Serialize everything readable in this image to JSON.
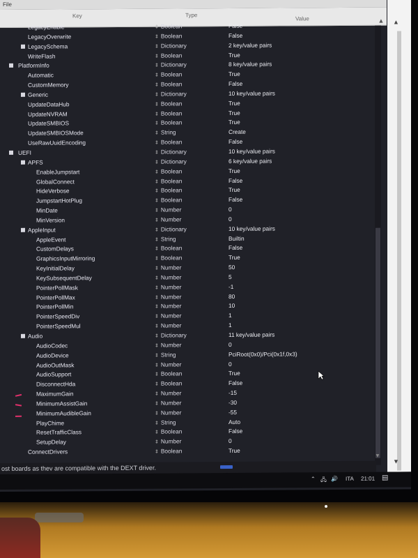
{
  "menu": {
    "file_label": "File"
  },
  "columns": {
    "key": "Key",
    "type": "Type",
    "value": "Value"
  },
  "rows": [
    {
      "key": "LegacyEnable",
      "indent": 2,
      "group": false,
      "type": "Boolean",
      "value": "False"
    },
    {
      "key": "LegacyOverwrite",
      "indent": 2,
      "group": false,
      "type": "Boolean",
      "value": "False"
    },
    {
      "key": "LegacySchema",
      "indent": 2,
      "group": true,
      "type": "Dictionary",
      "value": "2 key/value pairs"
    },
    {
      "key": "WriteFlash",
      "indent": 2,
      "group": false,
      "type": "Boolean",
      "value": "True"
    },
    {
      "key": "PlatformInfo",
      "indent": 1,
      "group": true,
      "type": "Dictionary",
      "value": "8 key/value pairs"
    },
    {
      "key": "Automatic",
      "indent": 2,
      "group": false,
      "type": "Boolean",
      "value": "True"
    },
    {
      "key": "CustomMemory",
      "indent": 2,
      "group": false,
      "type": "Boolean",
      "value": "False"
    },
    {
      "key": "Generic",
      "indent": 2,
      "group": true,
      "type": "Dictionary",
      "value": "10 key/value pairs"
    },
    {
      "key": "UpdateDataHub",
      "indent": 2,
      "group": false,
      "type": "Boolean",
      "value": "True"
    },
    {
      "key": "UpdateNVRAM",
      "indent": 2,
      "group": false,
      "type": "Boolean",
      "value": "True"
    },
    {
      "key": "UpdateSMBIOS",
      "indent": 2,
      "group": false,
      "type": "Boolean",
      "value": "True"
    },
    {
      "key": "UpdateSMBIOSMode",
      "indent": 2,
      "group": false,
      "type": "String",
      "value": "Create"
    },
    {
      "key": "UseRawUuidEncoding",
      "indent": 2,
      "group": false,
      "type": "Boolean",
      "value": "False"
    },
    {
      "key": "UEFI",
      "indent": 1,
      "group": true,
      "type": "Dictionary",
      "value": "10 key/value pairs"
    },
    {
      "key": "APFS",
      "indent": 2,
      "group": true,
      "type": "Dictionary",
      "value": "6 key/value pairs"
    },
    {
      "key": "EnableJumpstart",
      "indent": 3,
      "group": false,
      "type": "Boolean",
      "value": "True"
    },
    {
      "key": "GlobalConnect",
      "indent": 3,
      "group": false,
      "type": "Boolean",
      "value": "False"
    },
    {
      "key": "HideVerbose",
      "indent": 3,
      "group": false,
      "type": "Boolean",
      "value": "True"
    },
    {
      "key": "JumpstartHotPlug",
      "indent": 3,
      "group": false,
      "type": "Boolean",
      "value": "False"
    },
    {
      "key": "MinDate",
      "indent": 3,
      "group": false,
      "type": "Number",
      "value": "0"
    },
    {
      "key": "MinVersion",
      "indent": 3,
      "group": false,
      "type": "Number",
      "value": "0"
    },
    {
      "key": "AppleInput",
      "indent": 2,
      "group": true,
      "type": "Dictionary",
      "value": "10 key/value pairs"
    },
    {
      "key": "AppleEvent",
      "indent": 3,
      "group": false,
      "type": "String",
      "value": "Builtin"
    },
    {
      "key": "CustomDelays",
      "indent": 3,
      "group": false,
      "type": "Boolean",
      "value": "False"
    },
    {
      "key": "GraphicsInputMirroring",
      "indent": 3,
      "group": false,
      "type": "Boolean",
      "value": "True"
    },
    {
      "key": "KeyInitialDelay",
      "indent": 3,
      "group": false,
      "type": "Number",
      "value": "50"
    },
    {
      "key": "KeySubsequentDelay",
      "indent": 3,
      "group": false,
      "type": "Number",
      "value": "5"
    },
    {
      "key": "PointerPollMask",
      "indent": 3,
      "group": false,
      "type": "Number",
      "value": "-1"
    },
    {
      "key": "PointerPollMax",
      "indent": 3,
      "group": false,
      "type": "Number",
      "value": "80"
    },
    {
      "key": "PointerPollMin",
      "indent": 3,
      "group": false,
      "type": "Number",
      "value": "10"
    },
    {
      "key": "PointerSpeedDiv",
      "indent": 3,
      "group": false,
      "type": "Number",
      "value": "1"
    },
    {
      "key": "PointerSpeedMul",
      "indent": 3,
      "group": false,
      "type": "Number",
      "value": "1"
    },
    {
      "key": "Audio",
      "indent": 2,
      "group": true,
      "type": "Dictionary",
      "value": "11 key/value pairs"
    },
    {
      "key": "AudioCodec",
      "indent": 3,
      "group": false,
      "type": "Number",
      "value": "0"
    },
    {
      "key": "AudioDevice",
      "indent": 3,
      "group": false,
      "type": "String",
      "value": "PciRoot(0x0)/Pci(0x1f,0x3)"
    },
    {
      "key": "AudioOutMask",
      "indent": 3,
      "group": false,
      "type": "Number",
      "value": "0"
    },
    {
      "key": "AudioSupport",
      "indent": 3,
      "group": false,
      "type": "Boolean",
      "value": "True"
    },
    {
      "key": "DisconnectHda",
      "indent": 3,
      "group": false,
      "type": "Boolean",
      "value": "False"
    },
    {
      "key": "MaximumGain",
      "indent": 3,
      "group": false,
      "type": "Number",
      "value": "-15"
    },
    {
      "key": "MinimumAssistGain",
      "indent": 3,
      "group": false,
      "type": "Number",
      "value": "-30"
    },
    {
      "key": "MinimumAudibleGain",
      "indent": 3,
      "group": false,
      "type": "Number",
      "value": "-55"
    },
    {
      "key": "PlayChime",
      "indent": 3,
      "group": false,
      "type": "String",
      "value": "Auto"
    },
    {
      "key": "ResetTrafficClass",
      "indent": 3,
      "group": false,
      "type": "Boolean",
      "value": "False"
    },
    {
      "key": "SetupDelay",
      "indent": 3,
      "group": false,
      "type": "Number",
      "value": "0"
    },
    {
      "key": "ConnectDrivers",
      "indent": 2,
      "group": false,
      "type": "Boolean",
      "value": "True"
    }
  ],
  "status_line": "ost boards as thev are compatible with the DEXT driver.",
  "taskbar": {
    "language": "ITA",
    "time": "21:01"
  },
  "colors": {
    "table_bg": "#202128",
    "text": "#e6e6f0",
    "annotation": "#e0306a"
  }
}
